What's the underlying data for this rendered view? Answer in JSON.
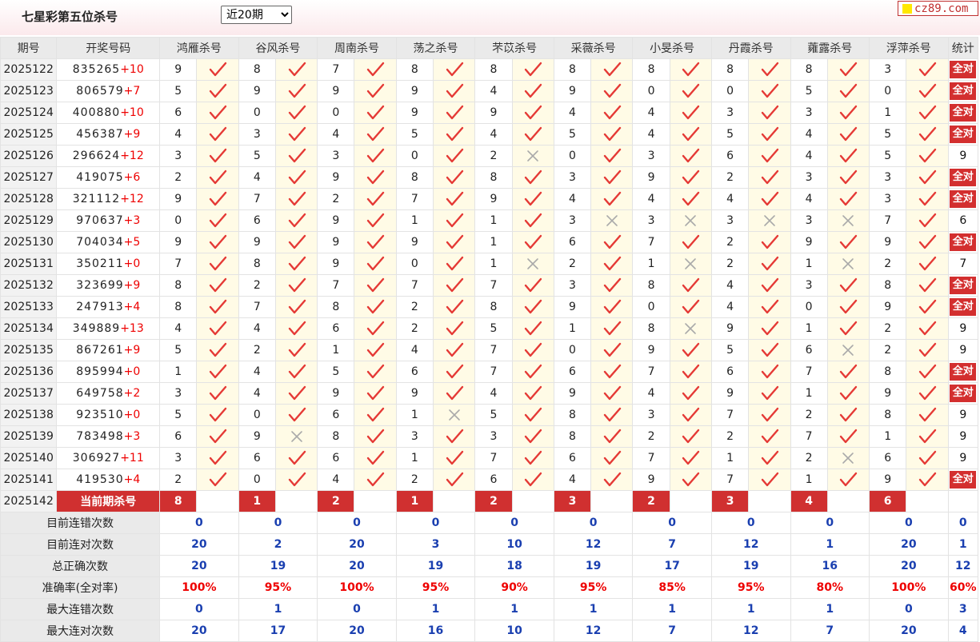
{
  "header": {
    "title": "七星彩第五位杀号",
    "period_select": "近20期",
    "logo": "cz89.com"
  },
  "columns": {
    "issue": "期号",
    "draw": "开奖号码",
    "killers": [
      "鸿雁杀号",
      "谷风杀号",
      "周南杀号",
      "荡之杀号",
      "芣苡杀号",
      "采薇杀号",
      "小旻杀号",
      "丹霞杀号",
      "蕹露杀号",
      "浮萍杀号"
    ],
    "stat": "统计"
  },
  "all_correct_label": "全对",
  "rows": [
    {
      "issue": "2025122",
      "draw": "835265",
      "sum": "+10",
      "picks": [
        [
          9,
          1
        ],
        [
          8,
          1
        ],
        [
          7,
          1
        ],
        [
          8,
          1
        ],
        [
          8,
          1
        ],
        [
          8,
          1
        ],
        [
          8,
          1
        ],
        [
          8,
          1
        ],
        [
          8,
          1
        ],
        [
          3,
          1
        ]
      ],
      "stat": "全对"
    },
    {
      "issue": "2025123",
      "draw": "806579",
      "sum": "+7",
      "picks": [
        [
          5,
          1
        ],
        [
          9,
          1
        ],
        [
          9,
          1
        ],
        [
          9,
          1
        ],
        [
          4,
          1
        ],
        [
          9,
          1
        ],
        [
          0,
          1
        ],
        [
          0,
          1
        ],
        [
          5,
          1
        ],
        [
          0,
          1
        ]
      ],
      "stat": "全对"
    },
    {
      "issue": "2025124",
      "draw": "400880",
      "sum": "+10",
      "picks": [
        [
          6,
          1
        ],
        [
          0,
          1
        ],
        [
          0,
          1
        ],
        [
          9,
          1
        ],
        [
          9,
          1
        ],
        [
          4,
          1
        ],
        [
          4,
          1
        ],
        [
          3,
          1
        ],
        [
          3,
          1
        ],
        [
          1,
          1
        ]
      ],
      "stat": "全对"
    },
    {
      "issue": "2025125",
      "draw": "456387",
      "sum": "+9",
      "picks": [
        [
          4,
          1
        ],
        [
          3,
          1
        ],
        [
          4,
          1
        ],
        [
          5,
          1
        ],
        [
          4,
          1
        ],
        [
          5,
          1
        ],
        [
          4,
          1
        ],
        [
          5,
          1
        ],
        [
          4,
          1
        ],
        [
          5,
          1
        ]
      ],
      "stat": "全对"
    },
    {
      "issue": "2025126",
      "draw": "296624",
      "sum": "+12",
      "picks": [
        [
          3,
          1
        ],
        [
          5,
          1
        ],
        [
          3,
          1
        ],
        [
          0,
          1
        ],
        [
          2,
          0
        ],
        [
          0,
          1
        ],
        [
          3,
          1
        ],
        [
          6,
          1
        ],
        [
          4,
          1
        ],
        [
          5,
          1
        ]
      ],
      "stat": "9"
    },
    {
      "issue": "2025127",
      "draw": "419075",
      "sum": "+6",
      "picks": [
        [
          2,
          1
        ],
        [
          4,
          1
        ],
        [
          9,
          1
        ],
        [
          8,
          1
        ],
        [
          8,
          1
        ],
        [
          3,
          1
        ],
        [
          9,
          1
        ],
        [
          2,
          1
        ],
        [
          3,
          1
        ],
        [
          3,
          1
        ]
      ],
      "stat": "全对"
    },
    {
      "issue": "2025128",
      "draw": "321112",
      "sum": "+12",
      "picks": [
        [
          9,
          1
        ],
        [
          7,
          1
        ],
        [
          2,
          1
        ],
        [
          7,
          1
        ],
        [
          9,
          1
        ],
        [
          4,
          1
        ],
        [
          4,
          1
        ],
        [
          4,
          1
        ],
        [
          4,
          1
        ],
        [
          3,
          1
        ]
      ],
      "stat": "全对"
    },
    {
      "issue": "2025129",
      "draw": "970637",
      "sum": "+3",
      "picks": [
        [
          0,
          1
        ],
        [
          6,
          1
        ],
        [
          9,
          1
        ],
        [
          1,
          1
        ],
        [
          1,
          1
        ],
        [
          3,
          0
        ],
        [
          3,
          0
        ],
        [
          3,
          0
        ],
        [
          3,
          0
        ],
        [
          7,
          1
        ]
      ],
      "stat": "6"
    },
    {
      "issue": "2025130",
      "draw": "704034",
      "sum": "+5",
      "picks": [
        [
          9,
          1
        ],
        [
          9,
          1
        ],
        [
          9,
          1
        ],
        [
          9,
          1
        ],
        [
          1,
          1
        ],
        [
          6,
          1
        ],
        [
          7,
          1
        ],
        [
          2,
          1
        ],
        [
          9,
          1
        ],
        [
          9,
          1
        ]
      ],
      "stat": "全对"
    },
    {
      "issue": "2025131",
      "draw": "350211",
      "sum": "+0",
      "picks": [
        [
          7,
          1
        ],
        [
          8,
          1
        ],
        [
          9,
          1
        ],
        [
          0,
          1
        ],
        [
          1,
          0
        ],
        [
          2,
          1
        ],
        [
          1,
          0
        ],
        [
          2,
          1
        ],
        [
          1,
          0
        ],
        [
          2,
          1
        ]
      ],
      "stat": "7"
    },
    {
      "issue": "2025132",
      "draw": "323699",
      "sum": "+9",
      "picks": [
        [
          8,
          1
        ],
        [
          2,
          1
        ],
        [
          7,
          1
        ],
        [
          7,
          1
        ],
        [
          7,
          1
        ],
        [
          3,
          1
        ],
        [
          8,
          1
        ],
        [
          4,
          1
        ],
        [
          3,
          1
        ],
        [
          8,
          1
        ]
      ],
      "stat": "全对"
    },
    {
      "issue": "2025133",
      "draw": "247913",
      "sum": "+4",
      "picks": [
        [
          8,
          1
        ],
        [
          7,
          1
        ],
        [
          8,
          1
        ],
        [
          2,
          1
        ],
        [
          8,
          1
        ],
        [
          9,
          1
        ],
        [
          0,
          1
        ],
        [
          4,
          1
        ],
        [
          0,
          1
        ],
        [
          9,
          1
        ]
      ],
      "stat": "全对"
    },
    {
      "issue": "2025134",
      "draw": "349889",
      "sum": "+13",
      "picks": [
        [
          4,
          1
        ],
        [
          4,
          1
        ],
        [
          6,
          1
        ],
        [
          2,
          1
        ],
        [
          5,
          1
        ],
        [
          1,
          1
        ],
        [
          8,
          0
        ],
        [
          9,
          1
        ],
        [
          1,
          1
        ],
        [
          2,
          1
        ]
      ],
      "stat": "9"
    },
    {
      "issue": "2025135",
      "draw": "867261",
      "sum": "+9",
      "picks": [
        [
          5,
          1
        ],
        [
          2,
          1
        ],
        [
          1,
          1
        ],
        [
          4,
          1
        ],
        [
          7,
          1
        ],
        [
          0,
          1
        ],
        [
          9,
          1
        ],
        [
          5,
          1
        ],
        [
          6,
          0
        ],
        [
          2,
          1
        ]
      ],
      "stat": "9"
    },
    {
      "issue": "2025136",
      "draw": "895994",
      "sum": "+0",
      "picks": [
        [
          1,
          1
        ],
        [
          4,
          1
        ],
        [
          5,
          1
        ],
        [
          6,
          1
        ],
        [
          7,
          1
        ],
        [
          6,
          1
        ],
        [
          7,
          1
        ],
        [
          6,
          1
        ],
        [
          7,
          1
        ],
        [
          8,
          1
        ]
      ],
      "stat": "全对"
    },
    {
      "issue": "2025137",
      "draw": "649758",
      "sum": "+2",
      "picks": [
        [
          3,
          1
        ],
        [
          4,
          1
        ],
        [
          9,
          1
        ],
        [
          9,
          1
        ],
        [
          4,
          1
        ],
        [
          9,
          1
        ],
        [
          4,
          1
        ],
        [
          9,
          1
        ],
        [
          1,
          1
        ],
        [
          9,
          1
        ]
      ],
      "stat": "全对"
    },
    {
      "issue": "2025138",
      "draw": "923510",
      "sum": "+0",
      "picks": [
        [
          5,
          1
        ],
        [
          0,
          1
        ],
        [
          6,
          1
        ],
        [
          1,
          0
        ],
        [
          5,
          1
        ],
        [
          8,
          1
        ],
        [
          3,
          1
        ],
        [
          7,
          1
        ],
        [
          2,
          1
        ],
        [
          8,
          1
        ]
      ],
      "stat": "9"
    },
    {
      "issue": "2025139",
      "draw": "783498",
      "sum": "+3",
      "picks": [
        [
          6,
          1
        ],
        [
          9,
          0
        ],
        [
          8,
          1
        ],
        [
          3,
          1
        ],
        [
          3,
          1
        ],
        [
          8,
          1
        ],
        [
          2,
          1
        ],
        [
          2,
          1
        ],
        [
          7,
          1
        ],
        [
          1,
          1
        ]
      ],
      "stat": "9"
    },
    {
      "issue": "2025140",
      "draw": "306927",
      "sum": "+11",
      "picks": [
        [
          3,
          1
        ],
        [
          6,
          1
        ],
        [
          6,
          1
        ],
        [
          1,
          1
        ],
        [
          7,
          1
        ],
        [
          6,
          1
        ],
        [
          7,
          1
        ],
        [
          1,
          1
        ],
        [
          2,
          0
        ],
        [
          6,
          1
        ]
      ],
      "stat": "9"
    },
    {
      "issue": "2025141",
      "draw": "419530",
      "sum": "+4",
      "picks": [
        [
          2,
          1
        ],
        [
          0,
          1
        ],
        [
          4,
          1
        ],
        [
          2,
          1
        ],
        [
          6,
          1
        ],
        [
          4,
          1
        ],
        [
          9,
          1
        ],
        [
          7,
          1
        ],
        [
          1,
          1
        ],
        [
          9,
          1
        ]
      ],
      "stat": "全对"
    }
  ],
  "current": {
    "issue": "2025142",
    "label": "当前期杀号",
    "values": [
      "8",
      "1",
      "2",
      "1",
      "2",
      "3",
      "2",
      "3",
      "4",
      "6"
    ]
  },
  "stats": [
    {
      "label": "目前连错次数",
      "values": [
        "0",
        "0",
        "0",
        "0",
        "0",
        "0",
        "0",
        "0",
        "0",
        "0"
      ],
      "total": "0",
      "style": "blue"
    },
    {
      "label": "目前连对次数",
      "values": [
        "20",
        "2",
        "20",
        "3",
        "10",
        "12",
        "7",
        "12",
        "1",
        "20"
      ],
      "total": "1",
      "style": "blue"
    },
    {
      "label": "总正确次数",
      "values": [
        "20",
        "19",
        "20",
        "19",
        "18",
        "19",
        "17",
        "19",
        "16",
        "20"
      ],
      "total": "12",
      "style": "blue"
    },
    {
      "label": "准确率(全对率)",
      "values": [
        "100%",
        "95%",
        "100%",
        "95%",
        "90%",
        "95%",
        "85%",
        "95%",
        "80%",
        "100%"
      ],
      "total": "60%",
      "style": "red"
    },
    {
      "label": "最大连错次数",
      "values": [
        "0",
        "1",
        "0",
        "1",
        "1",
        "1",
        "1",
        "1",
        "1",
        "0"
      ],
      "total": "3",
      "style": "blue"
    },
    {
      "label": "最大连对次数",
      "values": [
        "20",
        "17",
        "20",
        "16",
        "10",
        "12",
        "7",
        "12",
        "7",
        "20"
      ],
      "total": "4",
      "style": "blue"
    }
  ],
  "colors": {
    "accent_red": "#d32f2f",
    "tick_red": "#e53935",
    "cross_gray": "#aaaaaa",
    "stat_blue": "#1a3fb0",
    "mark_bg": "#fffbe6"
  },
  "icons": {
    "correct": "check-mark-icon",
    "wrong": "cross-mark-icon"
  }
}
